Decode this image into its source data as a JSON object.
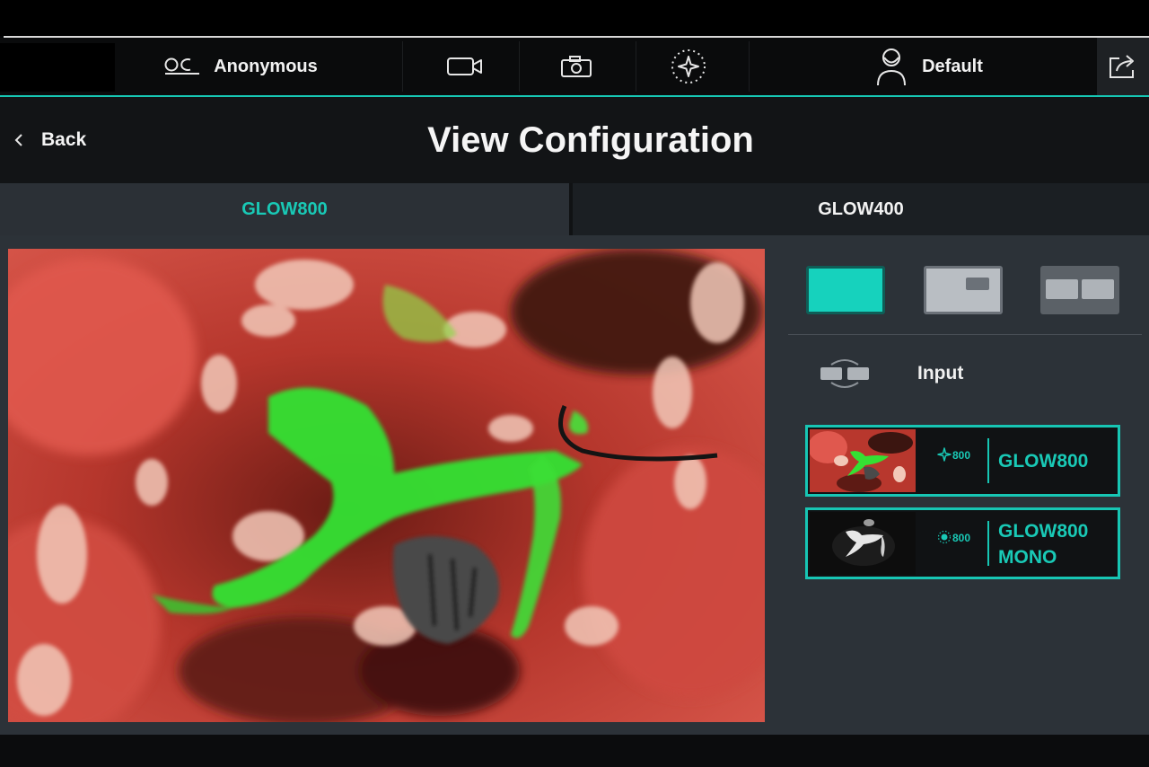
{
  "status_bar": {
    "patient": {
      "label": "Anonymous",
      "icon": "patient-id-icon"
    },
    "record_icon": "video-camera-icon",
    "snapshot_icon": "photo-camera-icon",
    "enhance_icon": "sparkle-circle-icon",
    "profile": {
      "label": "Default",
      "icon": "surgeon-profile-icon"
    },
    "share_icon": "export-share-icon"
  },
  "title_bar": {
    "back_label": "Back",
    "title": "View Configuration"
  },
  "tabs": [
    {
      "label": "GLOW800",
      "active": true
    },
    {
      "label": "GLOW400",
      "active": false
    }
  ],
  "layouts": [
    {
      "name": "single-view",
      "selected": true
    },
    {
      "name": "picture-in-picture",
      "selected": false
    },
    {
      "name": "side-by-side",
      "selected": false
    }
  ],
  "input": {
    "label": "Input",
    "icon": "swap-input-icon"
  },
  "sources": [
    {
      "badge": "800",
      "title": "GLOW800",
      "title_line2": "",
      "mode": "overlay"
    },
    {
      "badge": "800",
      "title": "GLOW800",
      "title_line2": "MONO",
      "mode": "mono"
    }
  ],
  "colors": {
    "accent": "#16c7b4",
    "tab_active_bg": "#2b3036",
    "tab_inactive_bg": "#1b1f23",
    "panel_bg": "#2c3238",
    "fluorescence_green": "#35e033",
    "tissue_red": "#c8443a"
  }
}
